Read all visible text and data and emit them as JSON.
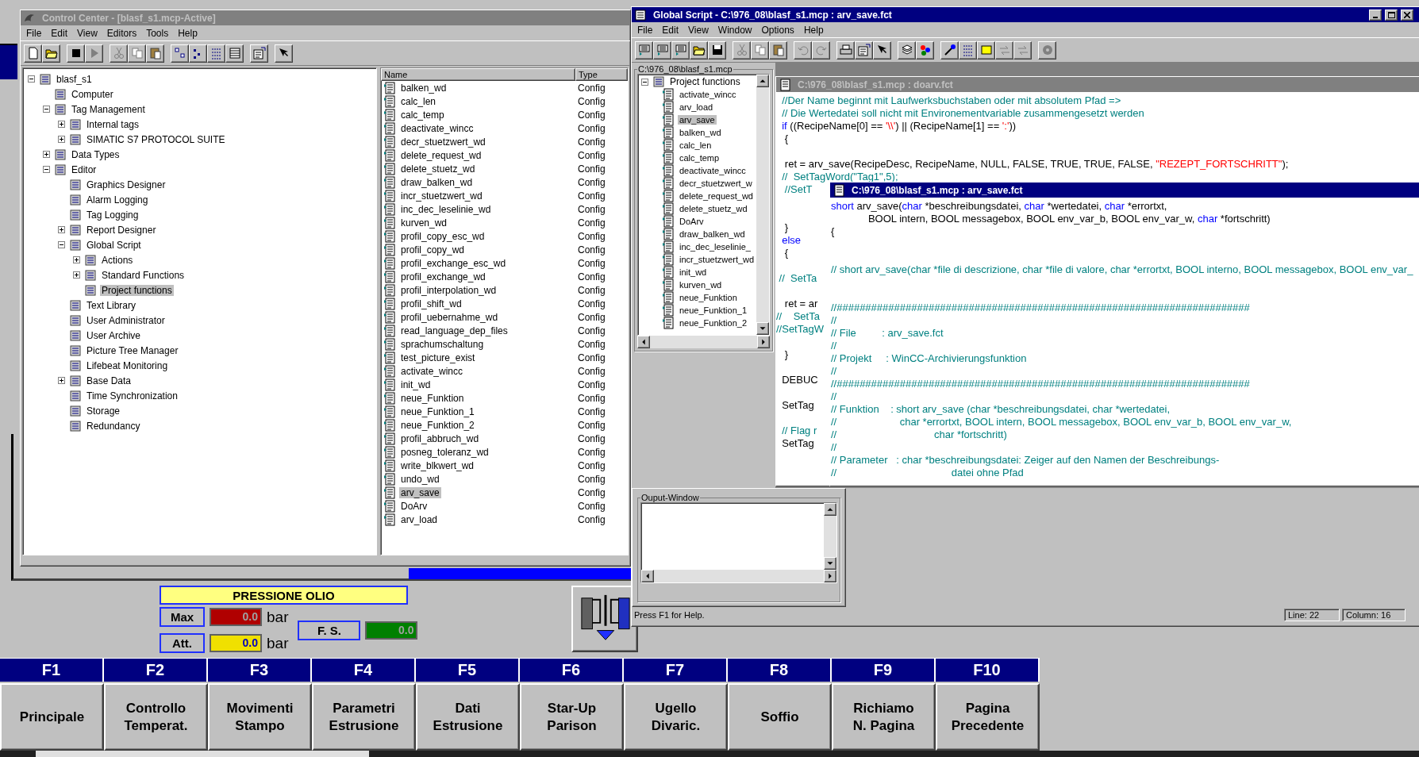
{
  "control_center": {
    "title": "Control Center - [blasf_s1.mcp-Active]",
    "menu": [
      "File",
      "Edit",
      "View",
      "Editors",
      "Tools",
      "Help"
    ],
    "tree": [
      {
        "label": "blasf_s1",
        "selected": false,
        "expanded": true,
        "children": [
          {
            "label": "Computer",
            "selected": false
          },
          {
            "label": "Tag Management",
            "selected": false,
            "expanded": true,
            "children": [
              {
                "label": "Internal tags",
                "selected": false,
                "expanded": false
              },
              {
                "label": "SIMATIC S7 PROTOCOL SUITE",
                "selected": false,
                "expanded": false
              }
            ]
          },
          {
            "label": "Data Types",
            "selected": false,
            "expanded": false
          },
          {
            "label": "Editor",
            "selected": false,
            "expanded": true,
            "children": [
              {
                "label": "Graphics Designer",
                "selected": false
              },
              {
                "label": "Alarm Logging",
                "selected": false
              },
              {
                "label": "Tag Logging",
                "selected": false
              },
              {
                "label": "Report Designer",
                "selected": false,
                "expanded": false
              },
              {
                "label": "Global Script",
                "selected": false,
                "expanded": true,
                "children": [
                  {
                    "label": "Actions",
                    "selected": false,
                    "expanded": false
                  },
                  {
                    "label": "Standard Functions",
                    "selected": false,
                    "expanded": false
                  },
                  {
                    "label": "Project functions",
                    "selected": true
                  }
                ]
              },
              {
                "label": "Text Library",
                "selected": false
              },
              {
                "label": "User Administrator",
                "selected": false
              },
              {
                "label": "User Archive",
                "selected": false
              },
              {
                "label": "Picture Tree Manager",
                "selected": false
              },
              {
                "label": "Lifebeat Monitoring",
                "selected": false
              },
              {
                "label": "Base Data",
                "selected": false,
                "expanded": false
              },
              {
                "label": "Time Synchronization",
                "selected": false
              },
              {
                "label": "Storage",
                "selected": false
              },
              {
                "label": "Redundancy",
                "selected": false
              }
            ]
          }
        ]
      }
    ],
    "list": {
      "columns": [
        "Name",
        "Type"
      ],
      "rows": [
        {
          "name": "balken_wd",
          "type": "Config",
          "selected": false
        },
        {
          "name": "calc_len",
          "type": "Config",
          "selected": false
        },
        {
          "name": "calc_temp",
          "type": "Config",
          "selected": false
        },
        {
          "name": "deactivate_wincc",
          "type": "Config",
          "selected": false
        },
        {
          "name": "decr_stuetzwert_wd",
          "type": "Config",
          "selected": false
        },
        {
          "name": "delete_request_wd",
          "type": "Config",
          "selected": false
        },
        {
          "name": "delete_stuetz_wd",
          "type": "Config",
          "selected": false
        },
        {
          "name": "draw_balken_wd",
          "type": "Config",
          "selected": false
        },
        {
          "name": "incr_stuetzwert_wd",
          "type": "Config",
          "selected": false
        },
        {
          "name": "inc_dec_leselinie_wd",
          "type": "Config",
          "selected": false
        },
        {
          "name": "kurven_wd",
          "type": "Config",
          "selected": false
        },
        {
          "name": "profil_copy_esc_wd",
          "type": "Config",
          "selected": false
        },
        {
          "name": "profil_copy_wd",
          "type": "Config",
          "selected": false
        },
        {
          "name": "profil_exchange_esc_wd",
          "type": "Config",
          "selected": false
        },
        {
          "name": "profil_exchange_wd",
          "type": "Config",
          "selected": false
        },
        {
          "name": "profil_interpolation_wd",
          "type": "Config",
          "selected": false
        },
        {
          "name": "profil_shift_wd",
          "type": "Config",
          "selected": false
        },
        {
          "name": "profil_uebernahme_wd",
          "type": "Config",
          "selected": false
        },
        {
          "name": "read_language_dep_files",
          "type": "Config",
          "selected": false
        },
        {
          "name": "sprachumschaltung",
          "type": "Config",
          "selected": false
        },
        {
          "name": "test_picture_exist",
          "type": "Config",
          "selected": false
        },
        {
          "name": "activate_wincc",
          "type": "Config",
          "selected": false
        },
        {
          "name": "init_wd",
          "type": "Config",
          "selected": false
        },
        {
          "name": "neue_Funktion",
          "type": "Config",
          "selected": false
        },
        {
          "name": "neue_Funktion_1",
          "type": "Config",
          "selected": false
        },
        {
          "name": "neue_Funktion_2",
          "type": "Config",
          "selected": false
        },
        {
          "name": "profil_abbruch_wd",
          "type": "Config",
          "selected": false
        },
        {
          "name": "posneg_toleranz_wd",
          "type": "Config",
          "selected": false
        },
        {
          "name": "write_blkwert_wd",
          "type": "Config",
          "selected": false
        },
        {
          "name": "undo_wd",
          "type": "Config",
          "selected": false
        },
        {
          "name": "arv_save",
          "type": "Config",
          "selected": true
        },
        {
          "name": "DoArv",
          "type": "Config",
          "selected": false
        },
        {
          "name": "arv_load",
          "type": "Config",
          "selected": false
        }
      ]
    }
  },
  "global_script": {
    "title": "Global Script - C:\\976_08\\blasf_s1.mcp : arv_save.fct",
    "menu": [
      "File",
      "Edit",
      "View",
      "Window",
      "Options",
      "Help"
    ],
    "tree_caption": "C:\\976_08\\blasf_s1.mcp",
    "tree": {
      "label": "Project functions",
      "expanded": true,
      "children": [
        {
          "label": "activate_wincc",
          "selected": false
        },
        {
          "label": "arv_load",
          "selected": false
        },
        {
          "label": "arv_save",
          "selected": true
        },
        {
          "label": "balken_wd",
          "selected": false
        },
        {
          "label": "calc_len",
          "selected": false
        },
        {
          "label": "calc_temp",
          "selected": false
        },
        {
          "label": "deactivate_wincc",
          "selected": false
        },
        {
          "label": "decr_stuetzwert_w",
          "selected": false
        },
        {
          "label": "delete_request_wd",
          "selected": false
        },
        {
          "label": "delete_stuetz_wd",
          "selected": false
        },
        {
          "label": "DoArv",
          "selected": false
        },
        {
          "label": "draw_balken_wd",
          "selected": false
        },
        {
          "label": "inc_dec_leselinie_",
          "selected": false
        },
        {
          "label": "incr_stuetzwert_wd",
          "selected": false
        },
        {
          "label": "init_wd",
          "selected": false
        },
        {
          "label": "kurven_wd",
          "selected": false
        },
        {
          "label": "neue_Funktion",
          "selected": false
        },
        {
          "label": "neue_Funktion_1",
          "selected": false
        },
        {
          "label": "neue_Funktion_2",
          "selected": false
        }
      ]
    },
    "editors": [
      {
        "title": "C:\\976_08\\blasf_s1.mcp : doarv.fct",
        "active": false,
        "lines": [
          {
            "kind": "code",
            "segments": [
              {
                "kind": "comment",
                "text": "  //Der Name beginnt mit Laufwerksbuchstaben oder mit absolutem Pfad =>"
              }
            ]
          },
          {
            "kind": "code",
            "segments": [
              {
                "kind": "comment",
                "text": "  // Die Wertedatei soll nicht mit Environementvariable zusammengesetzt werden"
              }
            ]
          },
          {
            "kind": "code",
            "segments": [
              {
                "kind": "keyword",
                "text": "  if"
              },
              {
                "kind": "code",
                "text": " ((RecipeName[0] == "
              },
              {
                "kind": "string",
                "text": "'\\\\'"
              },
              {
                "kind": "code",
                "text": ") || (RecipeName[1] == "
              },
              {
                "kind": "string",
                "text": "':'"
              },
              {
                "kind": "code",
                "text": "))"
              }
            ]
          },
          {
            "kind": "code",
            "segments": [
              {
                "kind": "code",
                "text": "   {"
              }
            ]
          },
          {
            "kind": "blank"
          },
          {
            "kind": "code",
            "segments": [
              {
                "kind": "code",
                "text": "   ret = arv_save(RecipeDesc, RecipeName, NULL, FALSE, TRUE, TRUE, FALSE, "
              },
              {
                "kind": "string",
                "text": "\"REZEPT_FORTSCHRITT\""
              },
              {
                "kind": "code",
                "text": ");"
              }
            ]
          },
          {
            "kind": "code",
            "segments": [
              {
                "kind": "comment",
                "text": "  //  SetTagWord(\"Tag1\",5);"
              }
            ]
          },
          {
            "kind": "code",
            "segments": [
              {
                "kind": "comment",
                "text": "   //SetT"
              }
            ]
          },
          {
            "kind": "blank"
          },
          {
            "kind": "blank"
          },
          {
            "kind": "code",
            "segments": [
              {
                "kind": "code",
                "text": "   }"
              }
            ]
          },
          {
            "kind": "code",
            "segments": [
              {
                "kind": "keyword",
                "text": "  else"
              }
            ]
          },
          {
            "kind": "code",
            "segments": [
              {
                "kind": "code",
                "text": "   {"
              }
            ]
          },
          {
            "kind": "blank"
          },
          {
            "kind": "code",
            "segments": [
              {
                "kind": "comment",
                "text": " //  SetTa"
              }
            ]
          },
          {
            "kind": "blank"
          },
          {
            "kind": "code",
            "segments": [
              {
                "kind": "code",
                "text": "   ret = ar"
              }
            ]
          },
          {
            "kind": "code",
            "segments": [
              {
                "kind": "comment",
                "text": "//    SetTa"
              }
            ]
          },
          {
            "kind": "code",
            "segments": [
              {
                "kind": "comment",
                "text": "//SetTagW"
              }
            ]
          },
          {
            "kind": "blank"
          },
          {
            "kind": "code",
            "segments": [
              {
                "kind": "code",
                "text": "   }"
              }
            ]
          },
          {
            "kind": "blank"
          },
          {
            "kind": "code",
            "segments": [
              {
                "kind": "code",
                "text": "  DEBUC"
              }
            ]
          },
          {
            "kind": "blank"
          },
          {
            "kind": "code",
            "segments": [
              {
                "kind": "code",
                "text": "  SetTag"
              }
            ]
          },
          {
            "kind": "blank"
          },
          {
            "kind": "code",
            "segments": [
              {
                "kind": "comment",
                "text": "  // Flag r"
              }
            ]
          },
          {
            "kind": "code",
            "segments": [
              {
                "kind": "code",
                "text": "  SetTag"
              }
            ]
          }
        ]
      },
      {
        "title": "C:\\976_08\\blasf_s1.mcp : arv_save.fct",
        "active": true,
        "lines": [
          {
            "kind": "code",
            "segments": [
              {
                "kind": "keyword",
                "text": "short"
              },
              {
                "kind": "code",
                "text": " arv_save("
              },
              {
                "kind": "keyword",
                "text": "char"
              },
              {
                "kind": "code",
                "text": " *beschreibungsdatei, "
              },
              {
                "kind": "keyword",
                "text": "char"
              },
              {
                "kind": "code",
                "text": " *wertedatei, "
              },
              {
                "kind": "keyword",
                "text": "char"
              },
              {
                "kind": "code",
                "text": " *errortxt,"
              }
            ]
          },
          {
            "kind": "code",
            "segments": [
              {
                "kind": "code",
                "text": "             BOOL intern, BOOL messagebox, BOOL env_var_b, BOOL env_var_w, "
              },
              {
                "kind": "keyword",
                "text": "char"
              },
              {
                "kind": "code",
                "text": " *fortschritt)"
              }
            ]
          },
          {
            "kind": "code",
            "segments": [
              {
                "kind": "code",
                "text": "{"
              }
            ]
          },
          {
            "kind": "blank"
          },
          {
            "kind": "blank"
          },
          {
            "kind": "code",
            "segments": [
              {
                "kind": "comment",
                "text": "// short arv_save(char *file di descrizione, char *file di valore, char *errortxt, BOOL interno, BOOL messagebox, BOOL env_var_"
              }
            ]
          },
          {
            "kind": "blank"
          },
          {
            "kind": "blank"
          },
          {
            "kind": "code",
            "segments": [
              {
                "kind": "comment",
                "text": "//########################################################################"
              }
            ]
          },
          {
            "kind": "code",
            "segments": [
              {
                "kind": "comment",
                "text": "//"
              }
            ]
          },
          {
            "kind": "code",
            "segments": [
              {
                "kind": "comment",
                "text": "// File         : arv_save.fct"
              }
            ]
          },
          {
            "kind": "code",
            "segments": [
              {
                "kind": "comment",
                "text": "//"
              }
            ]
          },
          {
            "kind": "code",
            "segments": [
              {
                "kind": "comment",
                "text": "// Projekt     : WinCC-Archivierungsfunktion"
              }
            ]
          },
          {
            "kind": "code",
            "segments": [
              {
                "kind": "comment",
                "text": "//"
              }
            ]
          },
          {
            "kind": "code",
            "segments": [
              {
                "kind": "comment",
                "text": "//########################################################################"
              }
            ]
          },
          {
            "kind": "code",
            "segments": [
              {
                "kind": "comment",
                "text": "//"
              }
            ]
          },
          {
            "kind": "code",
            "segments": [
              {
                "kind": "comment",
                "text": "// Funktion    : short arv_save (char *beschreibungsdatei, char *wertedatei,"
              }
            ]
          },
          {
            "kind": "code",
            "segments": [
              {
                "kind": "comment",
                "text": "//                      char *errortxt, BOOL intern, BOOL messagebox, BOOL env_var_b, BOOL env_var_w,"
              }
            ]
          },
          {
            "kind": "code",
            "segments": [
              {
                "kind": "comment",
                "text": "//                                  char *fortschritt)"
              }
            ]
          },
          {
            "kind": "code",
            "segments": [
              {
                "kind": "comment",
                "text": "//"
              }
            ]
          },
          {
            "kind": "code",
            "segments": [
              {
                "kind": "comment",
                "text": "// Parameter   : char *beschreibungsdatei: Zeiger auf den Namen der Beschreibungs-"
              }
            ]
          },
          {
            "kind": "code",
            "segments": [
              {
                "kind": "comment",
                "text": "//                                        datei ohne Pfad"
              }
            ]
          }
        ]
      }
    ],
    "output_window": {
      "caption": "Ouput-Window"
    },
    "status_bar": {
      "help": "Press F1 for Help.",
      "line": "Line: 22",
      "column": "Column: 16"
    }
  },
  "hmi": {
    "gauge_title": "PRESSIONE OLIO",
    "readings": [
      {
        "label": "Max",
        "value": "0.0",
        "unit": "bar",
        "color": "#b00000"
      },
      {
        "label": "Att.",
        "value": "0.0",
        "unit": "bar",
        "color": "#f0e000"
      }
    ],
    "full_scale": {
      "label": "F. S.",
      "value": "0.0",
      "color": "#008000"
    },
    "function_keys": [
      {
        "key": "F1",
        "label": "Principale"
      },
      {
        "key": "F2",
        "label": "Controllo\nTemperat."
      },
      {
        "key": "F3",
        "label": "Movimenti\nStampo"
      },
      {
        "key": "F4",
        "label": "Parametri\nEstrusione"
      },
      {
        "key": "F5",
        "label": "Dati\nEstrusione"
      },
      {
        "key": "F6",
        "label": "Star-Up\nParison"
      },
      {
        "key": "F7",
        "label": "Ugello\nDivaric."
      },
      {
        "key": "F8",
        "label": "Soffio"
      },
      {
        "key": "F9",
        "label": "Richiamo\nN. Pagina"
      },
      {
        "key": "F10",
        "label": "Pagina\nPrecedente"
      }
    ]
  }
}
